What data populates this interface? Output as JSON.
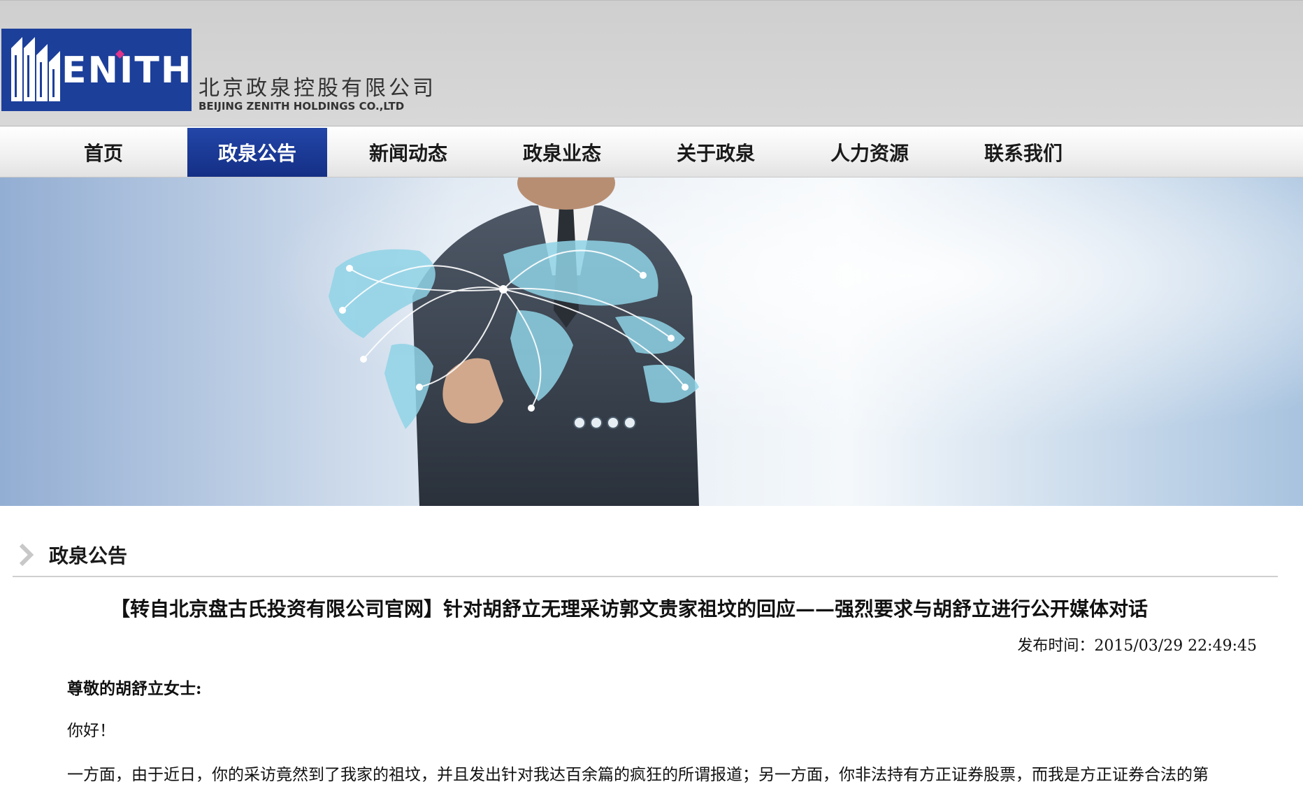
{
  "header": {
    "logo_text": "ENITH",
    "company_name_cn": "北京政泉控股有限公司",
    "company_name_en": "BEIJING ZENITH HOLDINGS CO.,LTD"
  },
  "nav": {
    "items": [
      {
        "label": "首页",
        "active": false
      },
      {
        "label": "政泉公告",
        "active": true
      },
      {
        "label": "新闻动态",
        "active": false
      },
      {
        "label": "政泉业态",
        "active": false
      },
      {
        "label": "关于政泉",
        "active": false
      },
      {
        "label": "人力资源",
        "active": false
      },
      {
        "label": "联系我们",
        "active": false
      }
    ]
  },
  "banner": {
    "slide_count": 4
  },
  "section": {
    "title": "政泉公告"
  },
  "article": {
    "title": "【转自北京盘古氏投资有限公司官网】针对胡舒立无理采访郭文贵家祖坟的回应——强烈要求与胡舒立进行公开媒体对话",
    "date": "发布时间：2015/03/29 22:49:45",
    "salutation": "尊敬的胡舒立女士:",
    "greeting": "你好！",
    "paragraph": "一方面，由于近日，你的采访竟然到了我家的祖坟，并且发出针对我达百余篇的疯狂的所谓报道；另一方面，你非法持有方正证券股票，而我是方正证券合法的第"
  },
  "colors": {
    "brand_blue": "#1c3f9a",
    "nav_active": "#1f3f9e",
    "logo_accent": "#e0338a"
  }
}
